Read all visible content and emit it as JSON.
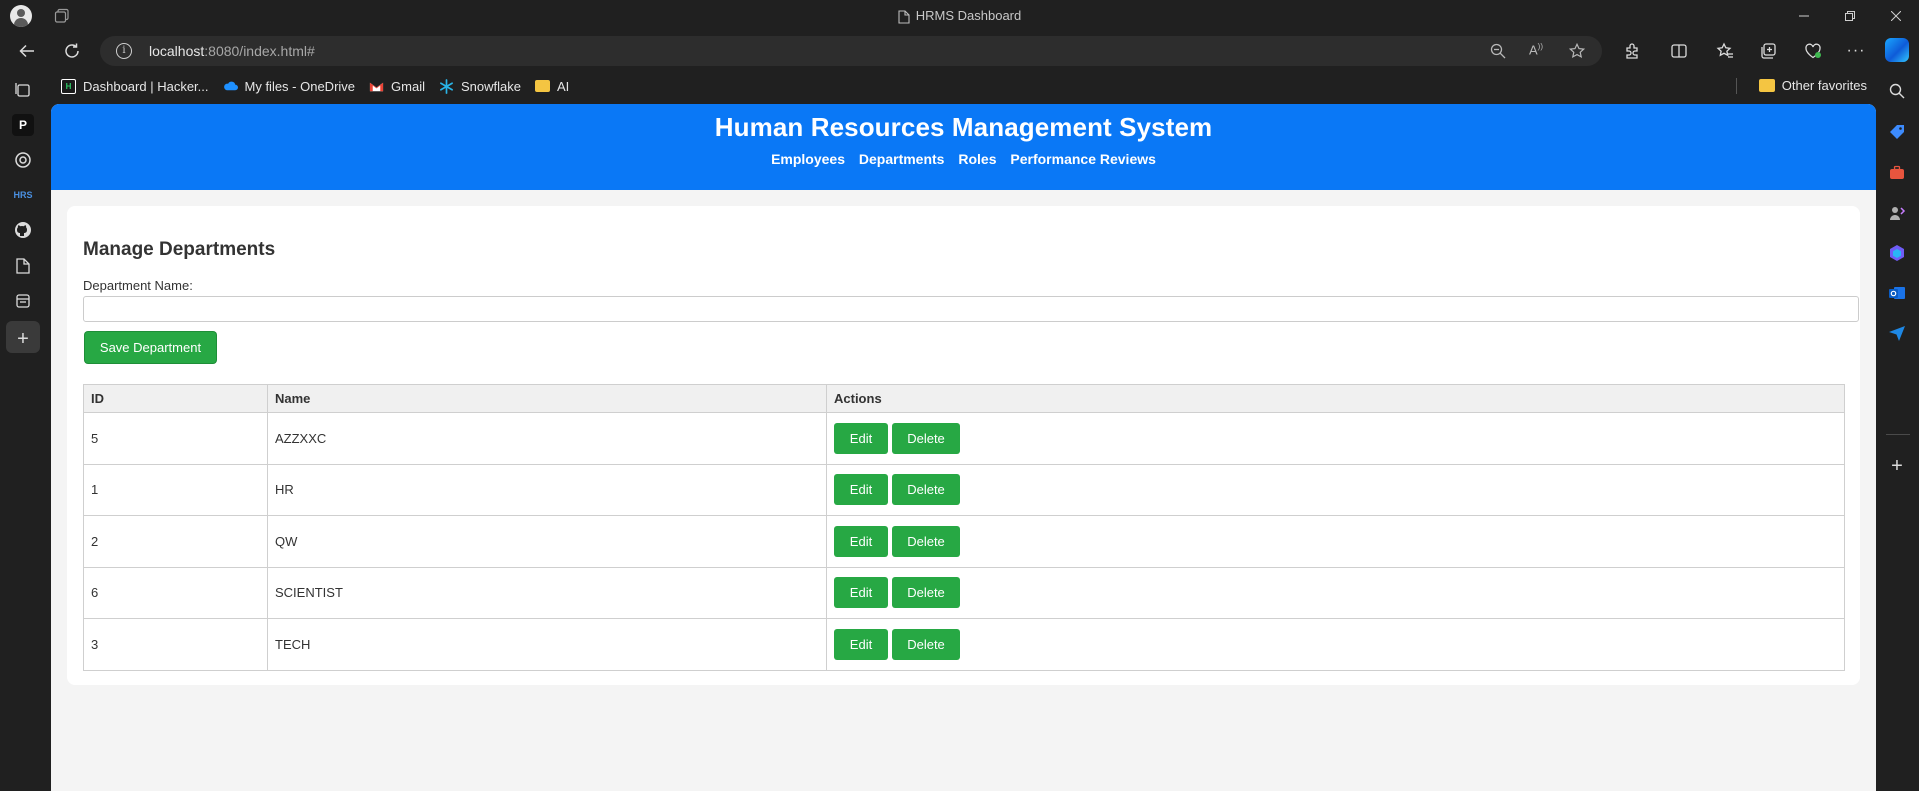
{
  "browser": {
    "window_title": "HRMS Dashboard",
    "url_host": "localhost",
    "url_rest": ":8080/index.html#",
    "bookmarks": [
      {
        "label": "Dashboard | Hacker...",
        "icon": "hackerrank-icon"
      },
      {
        "label": "My files - OneDrive",
        "icon": "onedrive-icon"
      },
      {
        "label": "Gmail",
        "icon": "gmail-icon"
      },
      {
        "label": "Snowflake",
        "icon": "snowflake-icon"
      },
      {
        "label": "AI",
        "icon": "folder-icon"
      }
    ],
    "other_favorites": "Other favorites"
  },
  "app": {
    "title": "Human Resources Management System",
    "nav": [
      "Employees",
      "Departments",
      "Roles",
      "Performance Reviews"
    ]
  },
  "departments": {
    "heading": "Manage Departments",
    "field_label": "Department Name:",
    "field_value": "",
    "save_label": "Save Department",
    "columns": [
      "ID",
      "Name",
      "Actions"
    ],
    "edit_label": "Edit",
    "delete_label": "Delete",
    "rows": [
      {
        "id": "5",
        "name": "AZZXXC"
      },
      {
        "id": "1",
        "name": "HR"
      },
      {
        "id": "2",
        "name": "QW"
      },
      {
        "id": "6",
        "name": "SCIENTIST"
      },
      {
        "id": "3",
        "name": "TECH"
      }
    ]
  },
  "colors": {
    "header_blue": "#0a78f6",
    "button_green": "#27a844",
    "page_bg": "#f4f4f4"
  }
}
